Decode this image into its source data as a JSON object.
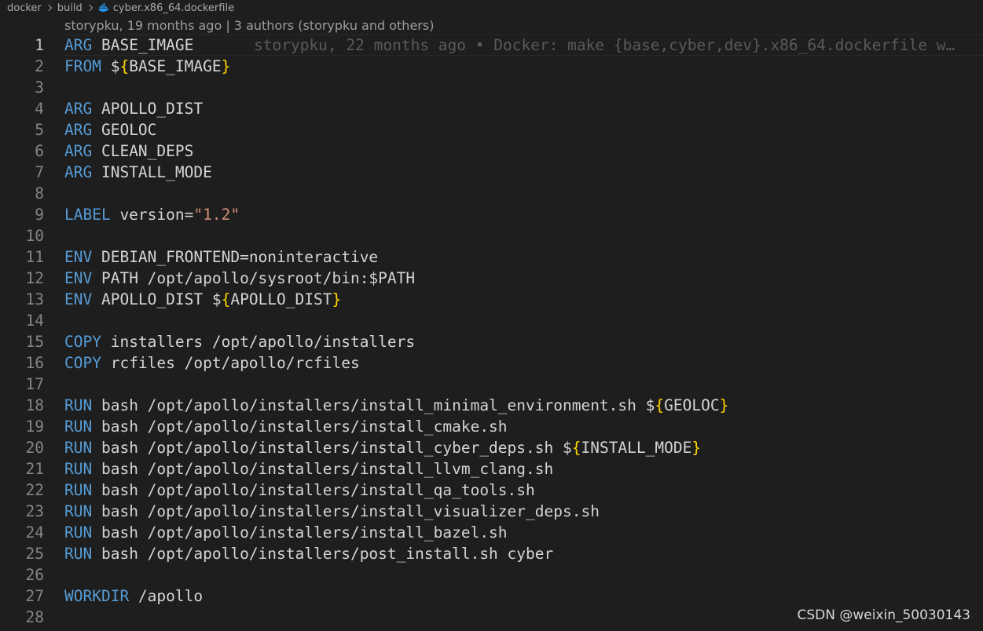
{
  "breadcrumb": {
    "items": [
      "docker",
      "build"
    ],
    "file": "cyber.x86_64.dockerfile",
    "file_icon": "docker-whale-icon"
  },
  "codelens": "storypku, 19 months ago | 3 authors (storypku and others)",
  "blame_inline": "storypku, 22 months ago • Docker: make {base,cyber,dev}.x86_64.dockerfile w…",
  "current_line": 1,
  "colors": {
    "keyword": "#569cd6",
    "text": "#d4d4d4",
    "string": "#ce9178",
    "brace": "#ffd700",
    "line_number": "#858585",
    "background": "#1e1e1e"
  },
  "lines": [
    {
      "n": "1",
      "tokens": [
        [
          "kw",
          "ARG"
        ],
        [
          "tx",
          " BASE_IMAGE"
        ]
      ]
    },
    {
      "n": "2",
      "tokens": [
        [
          "kw",
          "FROM"
        ],
        [
          "tx",
          " $"
        ],
        [
          "brace",
          "{"
        ],
        [
          "tx",
          "BASE_IMAGE"
        ],
        [
          "brace",
          "}"
        ]
      ]
    },
    {
      "n": "3",
      "tokens": []
    },
    {
      "n": "4",
      "tokens": [
        [
          "kw",
          "ARG"
        ],
        [
          "tx",
          " APOLLO_DIST"
        ]
      ]
    },
    {
      "n": "5",
      "tokens": [
        [
          "kw",
          "ARG"
        ],
        [
          "tx",
          " GEOLOC"
        ]
      ]
    },
    {
      "n": "6",
      "tokens": [
        [
          "kw",
          "ARG"
        ],
        [
          "tx",
          " CLEAN_DEPS"
        ]
      ]
    },
    {
      "n": "7",
      "tokens": [
        [
          "kw",
          "ARG"
        ],
        [
          "tx",
          " INSTALL_MODE"
        ]
      ]
    },
    {
      "n": "8",
      "tokens": []
    },
    {
      "n": "9",
      "tokens": [
        [
          "kw",
          "LABEL"
        ],
        [
          "tx",
          " version="
        ],
        [
          "str",
          "\"1.2\""
        ]
      ]
    },
    {
      "n": "10",
      "tokens": []
    },
    {
      "n": "11",
      "tokens": [
        [
          "kw",
          "ENV"
        ],
        [
          "tx",
          " DEBIAN_FRONTEND=noninteractive"
        ]
      ]
    },
    {
      "n": "12",
      "tokens": [
        [
          "kw",
          "ENV"
        ],
        [
          "tx",
          " PATH /opt/apollo/sysroot/bin:$PATH"
        ]
      ]
    },
    {
      "n": "13",
      "tokens": [
        [
          "kw",
          "ENV"
        ],
        [
          "tx",
          " APOLLO_DIST $"
        ],
        [
          "brace",
          "{"
        ],
        [
          "tx",
          "APOLLO_DIST"
        ],
        [
          "brace",
          "}"
        ]
      ]
    },
    {
      "n": "14",
      "tokens": []
    },
    {
      "n": "15",
      "tokens": [
        [
          "kw",
          "COPY"
        ],
        [
          "tx",
          " installers /opt/apollo/installers"
        ]
      ]
    },
    {
      "n": "16",
      "tokens": [
        [
          "kw",
          "COPY"
        ],
        [
          "tx",
          " rcfiles /opt/apollo/rcfiles"
        ]
      ]
    },
    {
      "n": "17",
      "tokens": []
    },
    {
      "n": "18",
      "tokens": [
        [
          "kw",
          "RUN"
        ],
        [
          "tx",
          " bash /opt/apollo/installers/install_minimal_environment.sh $"
        ],
        [
          "brace",
          "{"
        ],
        [
          "tx",
          "GEOLOC"
        ],
        [
          "brace",
          "}"
        ]
      ]
    },
    {
      "n": "19",
      "tokens": [
        [
          "kw",
          "RUN"
        ],
        [
          "tx",
          " bash /opt/apollo/installers/install_cmake.sh"
        ]
      ]
    },
    {
      "n": "20",
      "tokens": [
        [
          "kw",
          "RUN"
        ],
        [
          "tx",
          " bash /opt/apollo/installers/install_cyber_deps.sh $"
        ],
        [
          "brace",
          "{"
        ],
        [
          "tx",
          "INSTALL_MODE"
        ],
        [
          "brace",
          "}"
        ]
      ]
    },
    {
      "n": "21",
      "tokens": [
        [
          "kw",
          "RUN"
        ],
        [
          "tx",
          " bash /opt/apollo/installers/install_llvm_clang.sh"
        ]
      ]
    },
    {
      "n": "22",
      "tokens": [
        [
          "kw",
          "RUN"
        ],
        [
          "tx",
          " bash /opt/apollo/installers/install_qa_tools.sh"
        ]
      ]
    },
    {
      "n": "23",
      "tokens": [
        [
          "kw",
          "RUN"
        ],
        [
          "tx",
          " bash /opt/apollo/installers/install_visualizer_deps.sh"
        ]
      ]
    },
    {
      "n": "24",
      "tokens": [
        [
          "kw",
          "RUN"
        ],
        [
          "tx",
          " bash /opt/apollo/installers/install_bazel.sh"
        ]
      ]
    },
    {
      "n": "25",
      "tokens": [
        [
          "kw",
          "RUN"
        ],
        [
          "tx",
          " bash /opt/apollo/installers/post_install.sh cyber"
        ]
      ]
    },
    {
      "n": "26",
      "tokens": []
    },
    {
      "n": "27",
      "tokens": [
        [
          "kw",
          "WORKDIR"
        ],
        [
          "tx",
          " /apollo"
        ]
      ]
    },
    {
      "n": "28",
      "tokens": []
    }
  ],
  "watermark": "CSDN @weixin_50030143"
}
